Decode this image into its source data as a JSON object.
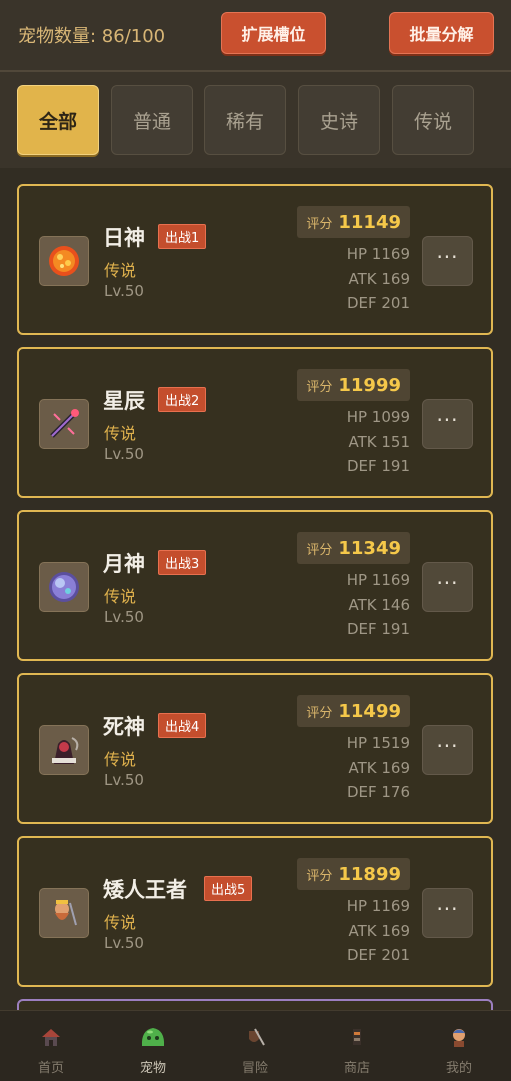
{
  "header": {
    "pet_count_label": "宠物数量: 86/100",
    "expand_button": "扩展槽位",
    "batch_button": "批量分解"
  },
  "tabs": [
    {
      "label": "全部",
      "active": true
    },
    {
      "label": "普通",
      "active": false
    },
    {
      "label": "稀有",
      "active": false
    },
    {
      "label": "史诗",
      "active": false
    },
    {
      "label": "传说",
      "active": false
    }
  ],
  "pets": [
    {
      "name": "日神",
      "badge": "出战1",
      "rarity": "传说",
      "level": "Lv.50",
      "score_label": "评分",
      "score": "11149",
      "hp": "HP 1169",
      "atk": "ATK 169",
      "def": "DEF 201",
      "more": "···",
      "icon": "sun-orb-icon"
    },
    {
      "name": "星辰",
      "badge": "出战2",
      "rarity": "传说",
      "level": "Lv.50",
      "score_label": "评分",
      "score": "11999",
      "hp": "HP 1099",
      "atk": "ATK 151",
      "def": "DEF 191",
      "more": "···",
      "icon": "star-staff-icon"
    },
    {
      "name": "月神",
      "badge": "出战3",
      "rarity": "传说",
      "level": "Lv.50",
      "score_label": "评分",
      "score": "11349",
      "hp": "HP 1169",
      "atk": "ATK 146",
      "def": "DEF 191",
      "more": "···",
      "icon": "moon-orb-icon"
    },
    {
      "name": "死神",
      "badge": "出战4",
      "rarity": "传说",
      "level": "Lv.50",
      "score_label": "评分",
      "score": "11499",
      "hp": "HP 1519",
      "atk": "ATK 169",
      "def": "DEF 176",
      "more": "···",
      "icon": "reaper-icon"
    },
    {
      "name": "矮人王者",
      "badge": "出战5",
      "rarity": "传说",
      "level": "Lv.50",
      "score_label": "评分",
      "score": "11899",
      "hp": "HP 1169",
      "atk": "ATK 169",
      "def": "DEF 201",
      "more": "···",
      "icon": "dwarf-king-icon"
    }
  ],
  "nav": [
    {
      "label": "首页",
      "icon": "home-icon",
      "active": false
    },
    {
      "label": "宠物",
      "icon": "slime-icon",
      "active": true
    },
    {
      "label": "冒险",
      "icon": "sword-shield-icon",
      "active": false
    },
    {
      "label": "商店",
      "icon": "shop-icon",
      "active": false
    },
    {
      "label": "我的",
      "icon": "profile-icon",
      "active": false
    }
  ],
  "colors": {
    "accent_gold": "#e1b44b",
    "button_red": "#c9502f",
    "legend_text": "#dfb14d",
    "score_gold": "#f5c84a"
  }
}
